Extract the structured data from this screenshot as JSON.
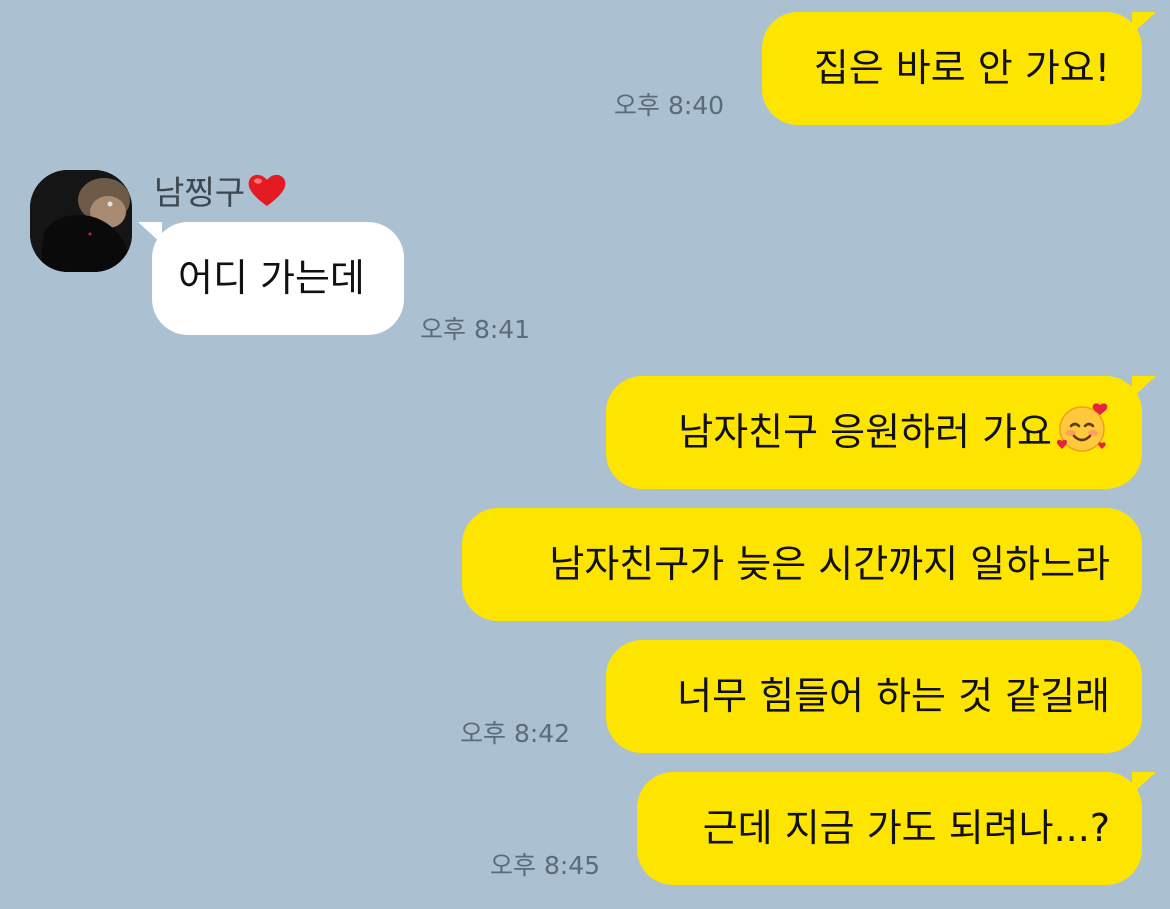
{
  "chat": {
    "contact_name": "남찡구",
    "contact_name_icon": "red-heart-icon",
    "messages": [
      {
        "side": "out",
        "text": "집은 바로 안 가요!",
        "time": "오후 8:40"
      },
      {
        "side": "in",
        "text": "어디 가는데",
        "time": "오후 8:41"
      },
      {
        "side": "out",
        "text": "남자친구 응원하러 가요",
        "emoji": "smiling-face-with-hearts-icon"
      },
      {
        "side": "out",
        "text": "남자친구가 늦은 시간까지 일하느라"
      },
      {
        "side": "out",
        "text": "너무 힘들어 하는 것 같길래",
        "time": "오후 8:42"
      },
      {
        "side": "out",
        "text": "근데 지금 가도 되려나...?",
        "time": "오후 8:45"
      }
    ]
  },
  "colors": {
    "background": "#abc1d1",
    "outgoing_bubble": "#fee500",
    "incoming_bubble": "#ffffff",
    "timestamp": "#5c6b78"
  }
}
